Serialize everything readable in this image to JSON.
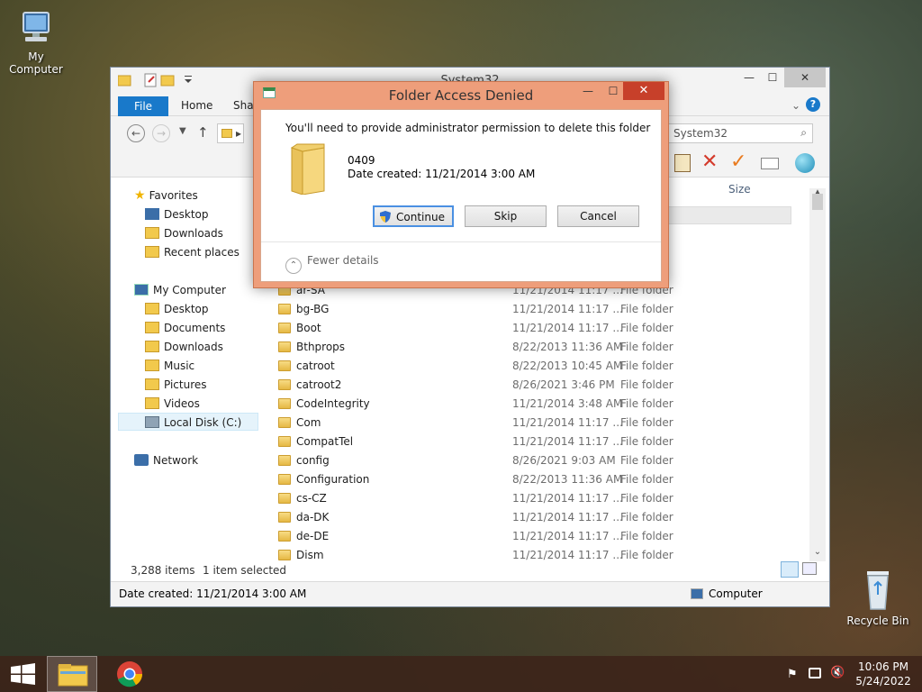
{
  "desktop": {
    "icons": [
      {
        "label": "My Computer"
      },
      {
        "label": "Recycle Bin"
      }
    ]
  },
  "explorer": {
    "title": "System32",
    "tabs": [
      "File",
      "Home",
      "Shar"
    ],
    "address_partial": "▸",
    "search_text": "System32",
    "nav": {
      "favorites": "Favorites",
      "fav_items": [
        "Desktop",
        "Downloads",
        "Recent places"
      ],
      "computer": "My Computer",
      "computer_items": [
        "Desktop",
        "Documents",
        "Downloads",
        "Music",
        "Pictures",
        "Videos",
        "Local Disk (C:)"
      ],
      "network": "Network"
    },
    "columns": {
      "size": "Size"
    },
    "rows": [
      {
        "name": "ar-SA",
        "date": "11/21/2014 11:17 ...",
        "type": "File folder"
      },
      {
        "name": "bg-BG",
        "date": "11/21/2014 11:17 ...",
        "type": "File folder"
      },
      {
        "name": "Boot",
        "date": "11/21/2014 11:17 ...",
        "type": "File folder"
      },
      {
        "name": "Bthprops",
        "date": "8/22/2013 11:36 AM",
        "type": "File folder"
      },
      {
        "name": "catroot",
        "date": "8/22/2013 10:45 AM",
        "type": "File folder"
      },
      {
        "name": "catroot2",
        "date": "8/26/2021 3:46 PM",
        "type": "File folder"
      },
      {
        "name": "CodeIntegrity",
        "date": "11/21/2014 3:48 AM",
        "type": "File folder"
      },
      {
        "name": "Com",
        "date": "11/21/2014 11:17 ...",
        "type": "File folder"
      },
      {
        "name": "CompatTel",
        "date": "11/21/2014 11:17 ...",
        "type": "File folder"
      },
      {
        "name": "config",
        "date": "8/26/2021 9:03 AM",
        "type": "File folder"
      },
      {
        "name": "Configuration",
        "date": "8/22/2013 11:36 AM",
        "type": "File folder"
      },
      {
        "name": "cs-CZ",
        "date": "11/21/2014 11:17 ...",
        "type": "File folder"
      },
      {
        "name": "da-DK",
        "date": "11/21/2014 11:17 ...",
        "type": "File folder"
      },
      {
        "name": "de-DE",
        "date": "11/21/2014 11:17 ...",
        "type": "File folder"
      },
      {
        "name": "Dism",
        "date": "11/21/2014 11:17 ...",
        "type": "File folder"
      }
    ],
    "status": {
      "items": "3,288 items",
      "selected": "1 item selected"
    },
    "details": {
      "date_created": "Date created: 11/21/2014 3:00 AM",
      "location": "Computer"
    }
  },
  "dialog": {
    "title": "Folder Access Denied",
    "message": "You'll need to provide administrator permission to delete this folder",
    "folder_name": "0409",
    "date_created": "Date created: 11/21/2014 3:00 AM",
    "buttons": {
      "continue": "Continue",
      "skip": "Skip",
      "cancel": "Cancel"
    },
    "fewer_details": "Fewer details"
  },
  "taskbar": {
    "time": "10:06 PM",
    "date": "5/24/2022"
  },
  "colors": {
    "dialog_frame": "#ee9e7b",
    "ribbon_file_tab": "#1979ca",
    "close_button": "#c7402a"
  }
}
